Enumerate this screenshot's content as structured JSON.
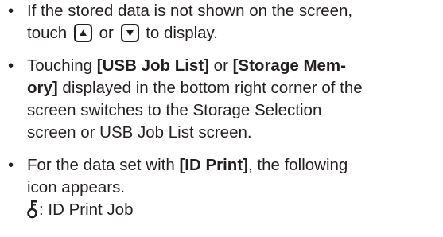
{
  "bullets": {
    "b1": {
      "text_before": "If the stored data is not shown on the screen,",
      "text_touch": "touch",
      "text_or": "or",
      "text_after": "to display."
    },
    "b2": {
      "text_1": "Touching ",
      "bold_1": "[USB Job List]",
      "text_2": " or ",
      "bold_2": "[Storage Mem-",
      "bold_3": "ory]",
      "text_3": " displayed in the bottom right corner of the",
      "text_4": "screen switches to the Storage Selection",
      "text_5": "screen or USB Job List screen."
    },
    "b3": {
      "text_1": "For the data set with ",
      "bold_1": "[ID Print]",
      "text_2": ", the following",
      "text_3": "icon appears.",
      "icon_label": ": ID Print Job"
    }
  },
  "icons": {
    "up": "up-arrow-button-icon",
    "down": "down-arrow-button-icon",
    "key": "key-icon"
  }
}
